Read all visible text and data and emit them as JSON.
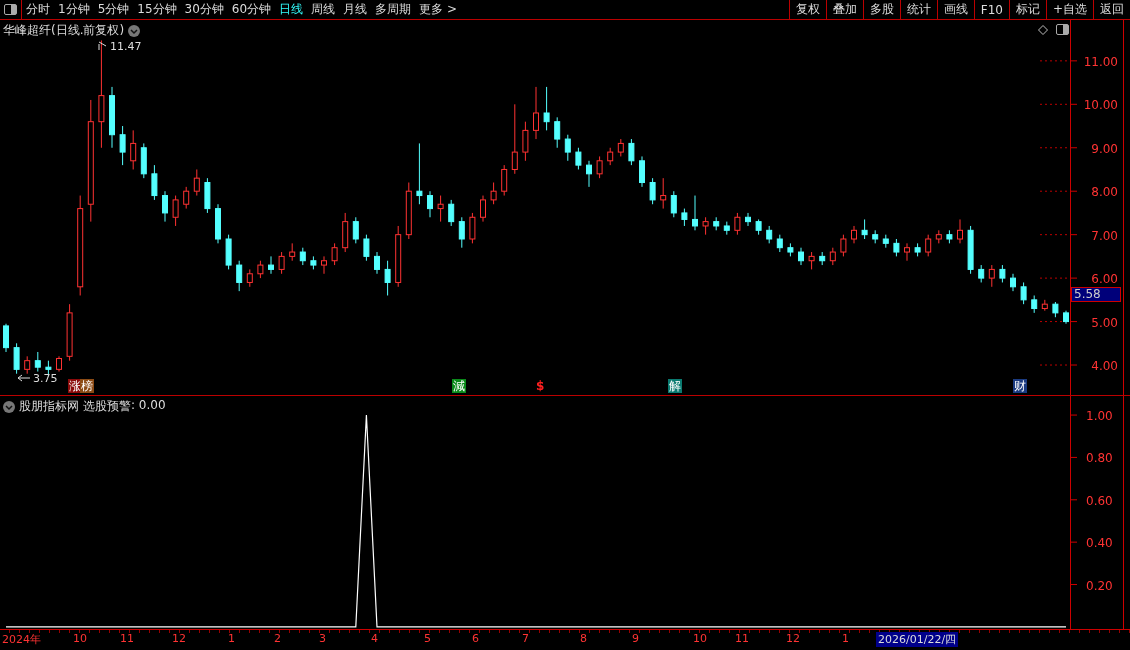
{
  "toolbar": {
    "periods": [
      {
        "label": "分时",
        "selected": false
      },
      {
        "label": "1分钟",
        "selected": false
      },
      {
        "label": "5分钟",
        "selected": false
      },
      {
        "label": "15分钟",
        "selected": false
      },
      {
        "label": "30分钟",
        "selected": false
      },
      {
        "label": "60分钟",
        "selected": false
      },
      {
        "label": "日线",
        "selected": true
      },
      {
        "label": "周线",
        "selected": false
      },
      {
        "label": "月线",
        "selected": false
      },
      {
        "label": "多周期",
        "selected": false
      },
      {
        "label": "更多 >",
        "selected": false
      }
    ],
    "actions": [
      "复权",
      "叠加",
      "多股",
      "统计",
      "画线",
      "F10",
      "标记",
      "+自选",
      "返回"
    ]
  },
  "main_chart": {
    "title": "华峰超纤(日线.前复权)",
    "high_label": "11.47",
    "low_label": "3.75",
    "current_price": "5.58",
    "chart_data": {
      "type": "candlestick",
      "ylim": [
        3.31,
        11.94
      ],
      "yticks": [
        {
          "value": 11,
          "label": "11.00"
        },
        {
          "value": 10,
          "label": "10.00"
        },
        {
          "value": 9,
          "label": "9.00"
        },
        {
          "value": 8,
          "label": "8.00"
        },
        {
          "value": 7,
          "label": "7.00"
        },
        {
          "value": 6,
          "label": "6.00"
        },
        {
          "value": 5,
          "label": "5.00"
        },
        {
          "value": 4,
          "label": "4.00"
        }
      ],
      "ohlc": [
        [
          4.9,
          4.95,
          4.3,
          4.4
        ],
        [
          4.4,
          4.5,
          3.8,
          3.9
        ],
        [
          3.9,
          4.2,
          3.8,
          4.1
        ],
        [
          4.1,
          4.3,
          3.85,
          3.95
        ],
        [
          3.95,
          4.1,
          3.75,
          3.9
        ],
        [
          3.9,
          4.2,
          3.85,
          4.15
        ],
        [
          4.2,
          5.4,
          4.1,
          5.2
        ],
        [
          5.8,
          7.9,
          5.6,
          7.6
        ],
        [
          7.7,
          10.1,
          7.3,
          9.6
        ],
        [
          9.6,
          11.47,
          9.0,
          10.2
        ],
        [
          10.2,
          10.4,
          9.0,
          9.3
        ],
        [
          9.3,
          9.5,
          8.6,
          8.9
        ],
        [
          8.7,
          9.4,
          8.5,
          9.1
        ],
        [
          9.0,
          9.1,
          8.3,
          8.4
        ],
        [
          8.4,
          8.6,
          7.8,
          7.9
        ],
        [
          7.9,
          8.0,
          7.3,
          7.5
        ],
        [
          7.4,
          7.9,
          7.2,
          7.8
        ],
        [
          7.7,
          8.1,
          7.6,
          8.0
        ],
        [
          8.0,
          8.5,
          7.9,
          8.3
        ],
        [
          8.2,
          8.3,
          7.5,
          7.6
        ],
        [
          7.6,
          7.7,
          6.8,
          6.9
        ],
        [
          6.9,
          7.0,
          6.2,
          6.3
        ],
        [
          6.3,
          6.4,
          5.7,
          5.9
        ],
        [
          5.9,
          6.2,
          5.8,
          6.1
        ],
        [
          6.1,
          6.4,
          6.0,
          6.3
        ],
        [
          6.3,
          6.5,
          6.1,
          6.2
        ],
        [
          6.2,
          6.6,
          6.1,
          6.5
        ],
        [
          6.5,
          6.8,
          6.4,
          6.6
        ],
        [
          6.6,
          6.7,
          6.3,
          6.4
        ],
        [
          6.4,
          6.5,
          6.2,
          6.3
        ],
        [
          6.3,
          6.5,
          6.1,
          6.4
        ],
        [
          6.4,
          6.8,
          6.3,
          6.7
        ],
        [
          6.7,
          7.5,
          6.6,
          7.3
        ],
        [
          7.3,
          7.4,
          6.8,
          6.9
        ],
        [
          6.9,
          7.0,
          6.4,
          6.5
        ],
        [
          6.5,
          6.6,
          6.1,
          6.2
        ],
        [
          6.2,
          6.4,
          5.6,
          5.9
        ],
        [
          5.9,
          7.2,
          5.8,
          7.0
        ],
        [
          7.0,
          8.2,
          6.9,
          8.0
        ],
        [
          8.0,
          9.1,
          7.7,
          7.9
        ],
        [
          7.9,
          8.0,
          7.4,
          7.6
        ],
        [
          7.6,
          7.9,
          7.3,
          7.7
        ],
        [
          7.7,
          7.8,
          7.2,
          7.3
        ],
        [
          7.3,
          7.4,
          6.7,
          6.9
        ],
        [
          6.9,
          7.5,
          6.8,
          7.4
        ],
        [
          7.4,
          7.9,
          7.3,
          7.8
        ],
        [
          7.8,
          8.2,
          7.7,
          8.0
        ],
        [
          8.0,
          8.6,
          7.9,
          8.5
        ],
        [
          8.5,
          10.0,
          8.4,
          8.9
        ],
        [
          8.9,
          9.6,
          8.7,
          9.4
        ],
        [
          9.4,
          10.4,
          9.2,
          9.8
        ],
        [
          9.8,
          10.4,
          9.4,
          9.6
        ],
        [
          9.6,
          9.7,
          9.0,
          9.2
        ],
        [
          9.2,
          9.3,
          8.7,
          8.9
        ],
        [
          8.9,
          9.0,
          8.5,
          8.6
        ],
        [
          8.6,
          8.7,
          8.1,
          8.4
        ],
        [
          8.4,
          8.8,
          8.3,
          8.7
        ],
        [
          8.7,
          9.0,
          8.6,
          8.9
        ],
        [
          8.9,
          9.2,
          8.8,
          9.1
        ],
        [
          9.1,
          9.2,
          8.6,
          8.7
        ],
        [
          8.7,
          8.8,
          8.1,
          8.2
        ],
        [
          8.2,
          8.3,
          7.7,
          7.8
        ],
        [
          7.8,
          8.3,
          7.6,
          7.9
        ],
        [
          7.9,
          8.0,
          7.4,
          7.5
        ],
        [
          7.5,
          7.6,
          7.2,
          7.35
        ],
        [
          7.35,
          7.9,
          7.1,
          7.2
        ],
        [
          7.2,
          7.4,
          7.0,
          7.3
        ],
        [
          7.3,
          7.4,
          7.1,
          7.2
        ],
        [
          7.2,
          7.3,
          7.0,
          7.1
        ],
        [
          7.1,
          7.5,
          7.0,
          7.4
        ],
        [
          7.4,
          7.5,
          7.2,
          7.3
        ],
        [
          7.3,
          7.35,
          7.0,
          7.1
        ],
        [
          7.1,
          7.2,
          6.8,
          6.9
        ],
        [
          6.9,
          7.0,
          6.6,
          6.7
        ],
        [
          6.7,
          6.8,
          6.5,
          6.6
        ],
        [
          6.6,
          6.7,
          6.3,
          6.4
        ],
        [
          6.4,
          6.6,
          6.2,
          6.5
        ],
        [
          6.5,
          6.6,
          6.3,
          6.4
        ],
        [
          6.4,
          6.7,
          6.3,
          6.6
        ],
        [
          6.6,
          7.0,
          6.5,
          6.9
        ],
        [
          6.9,
          7.2,
          6.8,
          7.1
        ],
        [
          7.1,
          7.35,
          6.9,
          7.0
        ],
        [
          7.0,
          7.1,
          6.8,
          6.9
        ],
        [
          6.9,
          7.0,
          6.7,
          6.8
        ],
        [
          6.8,
          6.9,
          6.5,
          6.6
        ],
        [
          6.6,
          6.8,
          6.4,
          6.7
        ],
        [
          6.7,
          6.8,
          6.5,
          6.6
        ],
        [
          6.6,
          7.0,
          6.5,
          6.9
        ],
        [
          6.9,
          7.1,
          6.8,
          7.0
        ],
        [
          7.0,
          7.1,
          6.8,
          6.9
        ],
        [
          6.9,
          7.35,
          6.8,
          7.1
        ],
        [
          7.1,
          7.2,
          6.1,
          6.2
        ],
        [
          6.2,
          6.3,
          5.9,
          6.0
        ],
        [
          6.0,
          6.3,
          5.8,
          6.2
        ],
        [
          6.2,
          6.3,
          5.9,
          6.0
        ],
        [
          6.0,
          6.1,
          5.7,
          5.8
        ],
        [
          5.8,
          5.9,
          5.4,
          5.5
        ],
        [
          5.5,
          5.6,
          5.2,
          5.3
        ],
        [
          5.3,
          5.5,
          5.25,
          5.4
        ],
        [
          5.4,
          5.45,
          5.1,
          5.2
        ],
        [
          5.2,
          5.25,
          4.95,
          5.0
        ]
      ]
    },
    "events": [
      {
        "label": "涨",
        "kind": "tag",
        "color": "#8b0a0a"
      },
      {
        "label": "榜",
        "kind": "tag",
        "color": "#8b4a14"
      },
      {
        "label": "減",
        "kind": "tag",
        "color": "#0a8a1a"
      },
      {
        "label": "$",
        "kind": "glyph",
        "color": "#ff2020"
      },
      {
        "label": "解",
        "kind": "tag",
        "color": "#0a7a70"
      },
      {
        "label": "财",
        "kind": "tag",
        "color": "#1a3a80"
      }
    ]
  },
  "indicator": {
    "name": "股朋指标网",
    "reading": ": 0.00",
    "chart_data": {
      "type": "line",
      "ylim": [
        -0.01,
        1.09
      ],
      "yticks": [
        {
          "value": 1,
          "label": "1.00"
        },
        {
          "value": 0.8,
          "label": "0.80"
        },
        {
          "value": 0.6,
          "label": "0.60"
        },
        {
          "value": 0.4,
          "label": "0.40"
        },
        {
          "value": 0.2,
          "label": "0.20"
        }
      ],
      "series": [
        {
          "name": "选股预警",
          "color": "#ffffff",
          "values": [
            0,
            0,
            0,
            0,
            0,
            0,
            0,
            0,
            0,
            0,
            0,
            0,
            0,
            0,
            0,
            0,
            0,
            0,
            0,
            0,
            0,
            0,
            0,
            0,
            0,
            0,
            0,
            0,
            0,
            0,
            0,
            0,
            0,
            0,
            1,
            0,
            0,
            0,
            0,
            0,
            0,
            0,
            0,
            0,
            0,
            0,
            0,
            0,
            0,
            0,
            0,
            0,
            0,
            0,
            0,
            0,
            0,
            0,
            0,
            0,
            0,
            0,
            0,
            0,
            0,
            0,
            0,
            0,
            0,
            0,
            0,
            0,
            0,
            0,
            0,
            0,
            0,
            0,
            0,
            0,
            0,
            0,
            0,
            0,
            0,
            0,
            0,
            0,
            0,
            0,
            0,
            0,
            0,
            0,
            0,
            0,
            0,
            0,
            0,
            0,
            0
          ]
        }
      ]
    }
  },
  "time_axis": {
    "labels": [
      "2024年",
      "10",
      "11",
      "12",
      "1",
      "2",
      "3",
      "4",
      "5",
      "6",
      "7",
      "8",
      "9",
      "10",
      "11",
      "12",
      "1"
    ],
    "cursor_date": "2026/01/22/四"
  }
}
